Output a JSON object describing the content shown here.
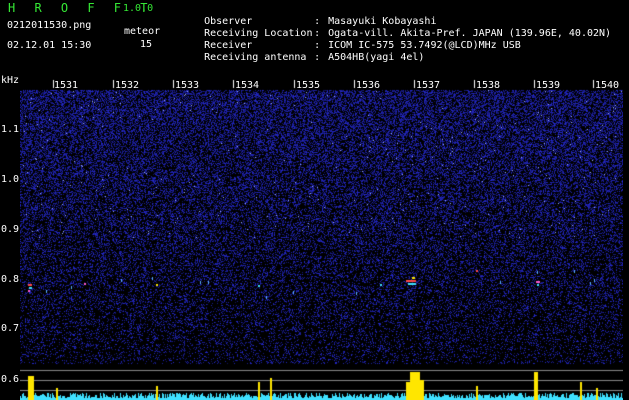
{
  "app": {
    "name": "H R O F F T",
    "version": "1.0.0"
  },
  "file": {
    "name": "0212011530.png",
    "datetime": "02.12.01 15:30"
  },
  "meteor": {
    "label": "meteor",
    "count": "15"
  },
  "info": [
    {
      "label": "Observer",
      "value": "Masayuki Kobayashi"
    },
    {
      "label": "Receiving Location",
      "value": "Ogata-vill. Akita-Pref. JAPAN (139.96E, 40.02N)"
    },
    {
      "label": "Receiver",
      "value": "ICOM IC-575 53.7492(@LCD)MHz USB"
    },
    {
      "label": "Receiving antenna",
      "value": "A504HB(yagi 4el)"
    }
  ],
  "axis": {
    "unit": "kHz",
    "y_labels": [
      "1.1",
      "1.0",
      "0.9",
      "0.8",
      "0.7",
      "0.6"
    ],
    "time_labels": [
      "1531",
      "1532",
      "1533",
      "1534",
      "1535",
      "1536",
      "1537",
      "1538",
      "1539",
      "1540"
    ]
  },
  "colors": {
    "background": "#000000",
    "noise": "#2a33a8",
    "header_green": "#35e835",
    "spectrum": "#3fe0ff",
    "peak": "#ffe600"
  }
}
